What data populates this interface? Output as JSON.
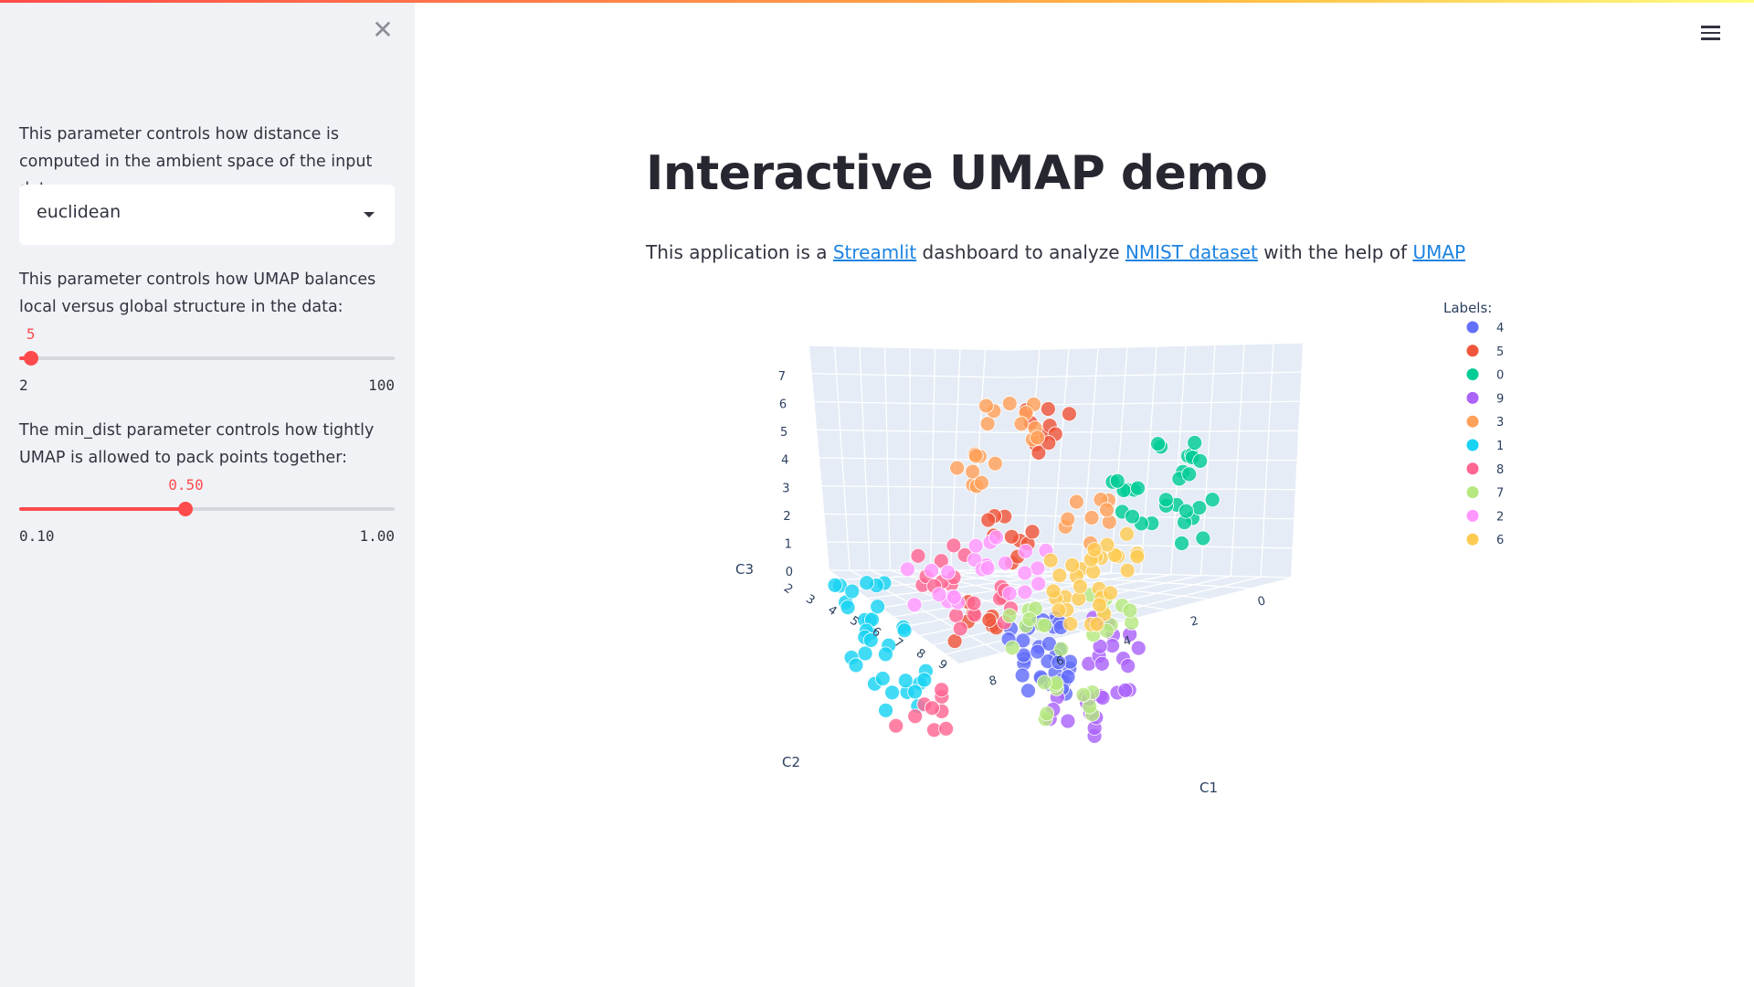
{
  "app": {
    "accent": "#ff4b4b",
    "link_color": "#1c83e1"
  },
  "sidebar": {
    "close_icon": "close-icon",
    "metric": {
      "description": "This parameter controls how distance is computed in the ambient space of the input data:",
      "selected": "euclidean"
    },
    "n_neighbors": {
      "description": "This parameter controls how UMAP balances local versus global structure in the data:",
      "value": "5",
      "min": "2",
      "max": "100",
      "fraction": 0.031
    },
    "min_dist": {
      "description": "The min_dist parameter controls how tightly UMAP is allowed to pack points together:",
      "value": "0.50",
      "min": "0.10",
      "max": "1.00",
      "fraction": 0.444
    }
  },
  "header": {
    "menu_icon": "hamburger-menu-icon"
  },
  "main": {
    "title": "Interactive UMAP demo",
    "intro": {
      "prefix": "This application is a ",
      "link1": "Streamlit",
      "mid1": " dashboard to analyze ",
      "link2": "NMIST dataset",
      "mid2": " with the help of ",
      "link3": "UMAP"
    }
  },
  "chart_data": {
    "type": "scatter",
    "projection": "3d",
    "xlabel": "C1",
    "ylabel": "C2",
    "zlabel": "C3",
    "xticks": [
      "0",
      "2",
      "4",
      "6",
      "8"
    ],
    "yticks": [
      "2",
      "3",
      "4",
      "5",
      "6",
      "7",
      "8",
      "9"
    ],
    "zticks": [
      "0",
      "1",
      "2",
      "3",
      "4",
      "5",
      "6",
      "7"
    ],
    "legend_title": "Labels:",
    "legend_position": "top-right",
    "series": [
      {
        "name": "4",
        "color": "#636efa"
      },
      {
        "name": "5",
        "color": "#ef553b"
      },
      {
        "name": "0",
        "color": "#00cc96"
      },
      {
        "name": "9",
        "color": "#ab63fa"
      },
      {
        "name": "3",
        "color": "#ffa15a"
      },
      {
        "name": "1",
        "color": "#19d3f3"
      },
      {
        "name": "8",
        "color": "#ff6692"
      },
      {
        "name": "7",
        "color": "#b6e880"
      },
      {
        "name": "2",
        "color": "#ff97ff"
      },
      {
        "name": "6",
        "color": "#fecb52"
      }
    ]
  }
}
